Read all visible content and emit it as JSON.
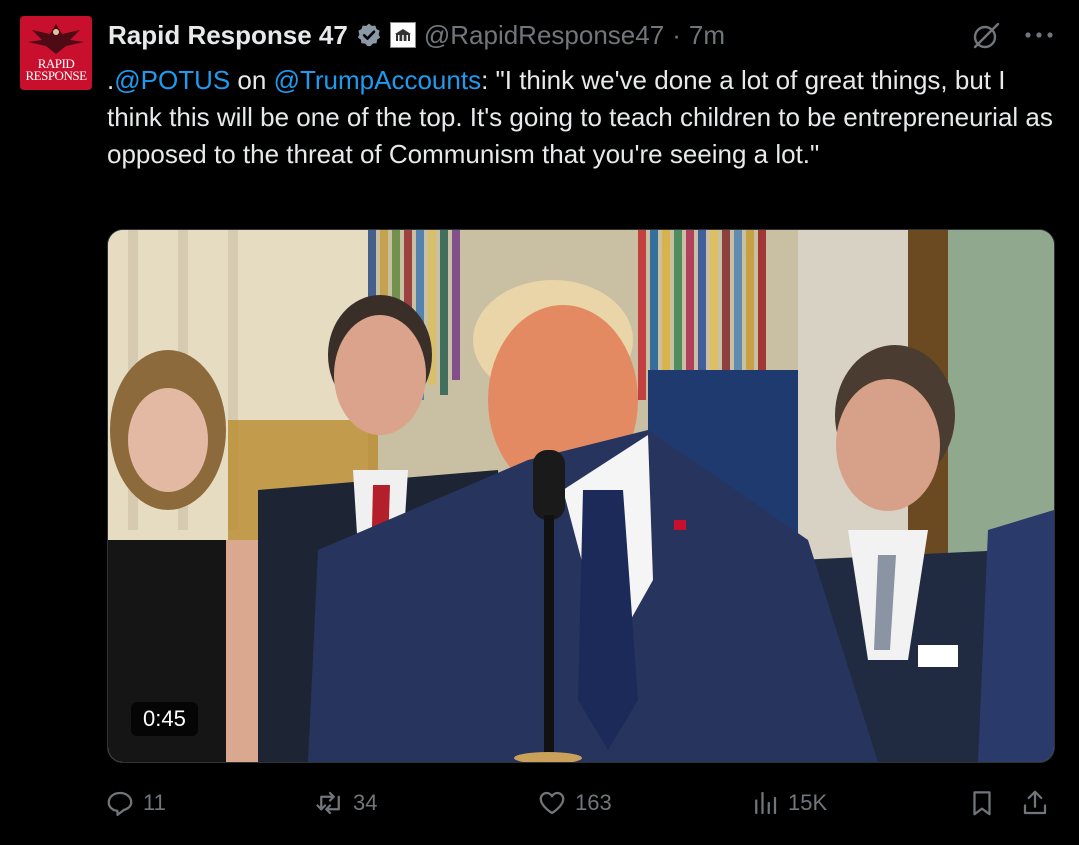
{
  "post": {
    "avatar_text_line1": "RAPID",
    "avatar_text_line2": "RESPONSE",
    "author_name": "Rapid Response 47",
    "handle": "@RapidResponse47",
    "separator": "·",
    "time": "7m",
    "text_prefix": ".",
    "mention1": "@POTUS",
    "text_mid": " on ",
    "mention2": "@TrumpAccounts",
    "text_body": ": \"I think we've done a lot of great things, but I think this will be one of the top. It's going to teach children to be entrepreneurial as opposed to the threat of Communism that you're seeing a lot.\"",
    "video_duration": "0:45"
  },
  "actions": {
    "replies": "11",
    "reposts": "34",
    "likes": "163",
    "views": "15K"
  },
  "colors": {
    "background": "#000000",
    "text": "#e7e9ea",
    "muted": "#71767b",
    "link": "#1d9bf0",
    "verified": "#1d9bf0",
    "avatar_red": "#c8102e"
  },
  "icons": {
    "verified": "verified-badge-icon",
    "affiliation": "white-house-affiliation-icon",
    "grok": "grok-icon",
    "more": "more-dots-icon",
    "reply": "reply-icon",
    "repost": "repost-icon",
    "like": "heart-icon",
    "views": "views-chart-icon",
    "bookmark": "bookmark-icon",
    "share": "share-icon"
  }
}
